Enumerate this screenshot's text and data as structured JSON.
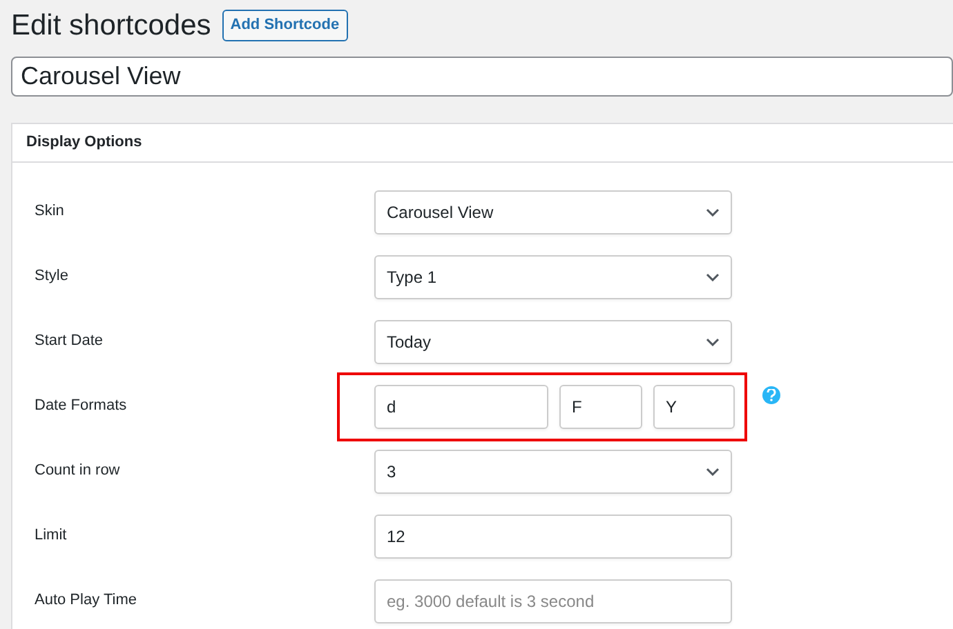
{
  "page_title": "Edit shortcodes",
  "add_button": "Add Shortcode",
  "title_field": {
    "value": "Carousel View"
  },
  "panel": {
    "title": "Display Options",
    "rows": [
      {
        "kind": "select",
        "label": "Skin",
        "value": "Carousel View"
      },
      {
        "kind": "select",
        "label": "Style",
        "value": "Type 1"
      },
      {
        "kind": "select",
        "label": "Start Date",
        "value": "Today"
      },
      {
        "kind": "formats",
        "label": "Date Formats",
        "values": [
          "d",
          "F",
          "Y"
        ],
        "highlighted": true,
        "help": true
      },
      {
        "kind": "select",
        "label": "Count in row",
        "value": "3"
      },
      {
        "kind": "input",
        "label": "Limit",
        "value": "12"
      },
      {
        "kind": "input",
        "label": "Auto Play Time",
        "placeholder": "eg. 3000 default is 3 second"
      }
    ]
  }
}
